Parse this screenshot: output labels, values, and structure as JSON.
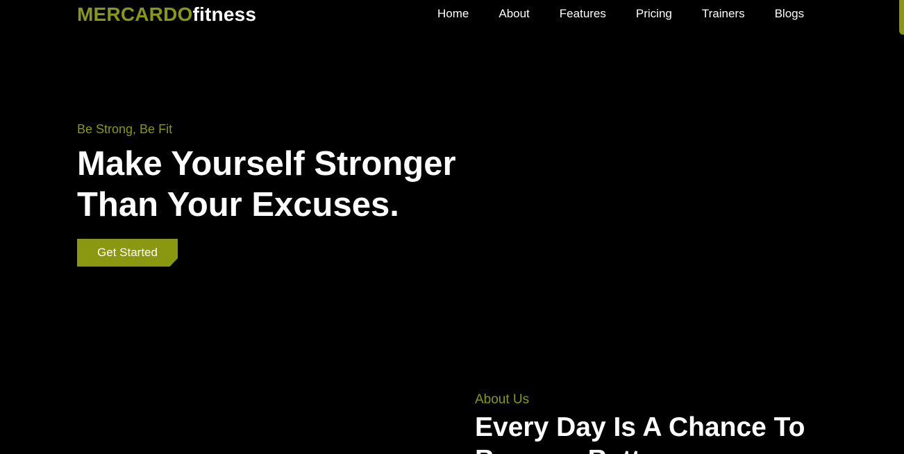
{
  "header": {
    "logo_accent": "MERCARDO",
    "logo_rest": "fitness",
    "nav": [
      "Home",
      "About",
      "Features",
      "Pricing",
      "Trainers",
      "Blogs"
    ]
  },
  "hero": {
    "tagline": "Be Strong, Be Fit",
    "title_line1": "Make Yourself Stronger",
    "title_line2": "Than Your Excuses.",
    "cta_label": "Get Started"
  },
  "about": {
    "tagline": "About Us",
    "title": "Every Day Is A Chance To Become Better"
  },
  "colors": {
    "accent": "#8a9711",
    "background": "#000000",
    "text": "#ffffff"
  }
}
